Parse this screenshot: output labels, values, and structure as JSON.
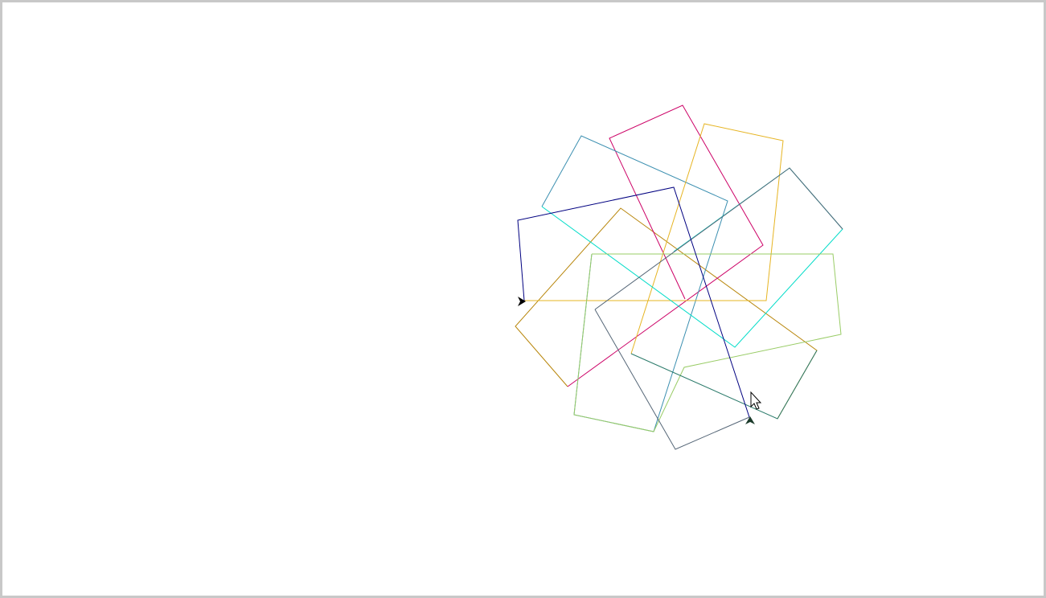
{
  "canvas": {
    "background": "#ffffff",
    "border_color": "#c8c8c8"
  },
  "drawing": {
    "shape": "rectangle",
    "count": 9,
    "stroke_colors": [
      "#b8860b",
      "#cc0066",
      "#3399aa",
      "#e6b422",
      "#00dcc8",
      "#99cc66",
      "#556677",
      "#2a7a6a",
      "#4d8a9a",
      "#000080"
    ]
  },
  "turtles": [
    {
      "name": "turtle-start",
      "icon": "turtle-arrow-icon",
      "color": "#000000"
    },
    {
      "name": "turtle-active",
      "icon": "turtle-arrow-icon",
      "color": "#1a3a2a"
    }
  ],
  "cursor": {
    "icon": "mouse-pointer-icon"
  }
}
